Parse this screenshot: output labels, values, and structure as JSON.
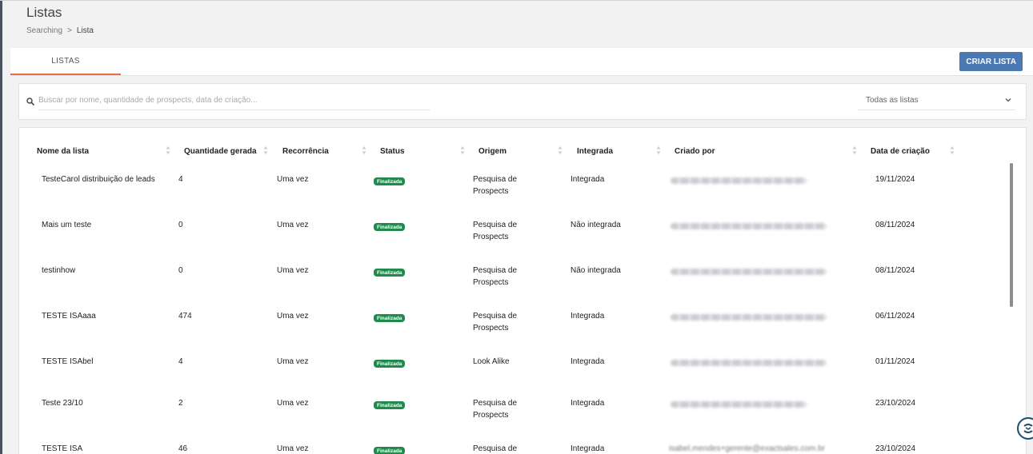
{
  "header": {
    "title": "Listas",
    "breadcrumb": {
      "parent": "Searching",
      "separator": ">",
      "current": "Lista"
    }
  },
  "tabs": [
    {
      "label": "LISTAS",
      "active": true
    }
  ],
  "toolbar": {
    "create_label": "CRIAR LISTA"
  },
  "search": {
    "placeholder": "Buscar por nome, quantidade de prospects, data de criação...",
    "value": "",
    "filter_value": "Todas as listas"
  },
  "table": {
    "headers": [
      "Nome da lista",
      "Quantidade gerada",
      "Recorrência",
      "Status",
      "Origem",
      "Integrada",
      "Criado por",
      "Data de criação"
    ],
    "rows": [
      {
        "name": "TesteCarol distribuição de leads",
        "quantity": "4",
        "recurrence": "Uma vez",
        "status": "Finalizada",
        "origin": "Pesquisa de Prospects",
        "integrated": "Integrada",
        "created_by": "",
        "date": "19/11/2024"
      },
      {
        "name": "Mais um teste",
        "quantity": "0",
        "recurrence": "Uma vez",
        "status": "Finalizada",
        "origin": "Pesquisa de Prospects",
        "integrated": "Não integrada",
        "created_by": "",
        "date": "08/11/2024"
      },
      {
        "name": "testinhow",
        "quantity": "0",
        "recurrence": "Uma vez",
        "status": "Finalizada",
        "origin": "Pesquisa de Prospects",
        "integrated": "Não integrada",
        "created_by": "",
        "date": "08/11/2024"
      },
      {
        "name": "TESTE ISAaaa",
        "quantity": "474",
        "recurrence": "Uma vez",
        "status": "Finalizada",
        "origin": "Pesquisa de Prospects",
        "integrated": "Integrada",
        "created_by": "",
        "date": "06/11/2024"
      },
      {
        "name": "TESTE ISAbel",
        "quantity": "4",
        "recurrence": "Uma vez",
        "status": "Finalizada",
        "origin": "Look Alike",
        "integrated": "Integrada",
        "created_by": "",
        "date": "01/11/2024"
      },
      {
        "name": "Teste 23/10",
        "quantity": "2",
        "recurrence": "Uma vez",
        "status": "Finalizada",
        "origin": "Pesquisa de Prospects",
        "integrated": "Integrada",
        "created_by": "",
        "date": "23/10/2024"
      },
      {
        "name": "TESTE ISA",
        "quantity": "46",
        "recurrence": "Uma vez",
        "status": "Finalizada",
        "origin": "Pesquisa de",
        "integrated": "Integrada",
        "created_by": "isabel.mendes+gerente@exactsales.com.br",
        "date": "23/10/2024"
      }
    ]
  },
  "colors": {
    "accent": "#e27044",
    "primary_button": "#4a79b4",
    "status_badge": "#1f8a4c"
  },
  "icons": {
    "search": "search-icon",
    "filter": "chevron-down-icon",
    "sort": "sort-icon",
    "chat": "chat-widget-icon"
  }
}
